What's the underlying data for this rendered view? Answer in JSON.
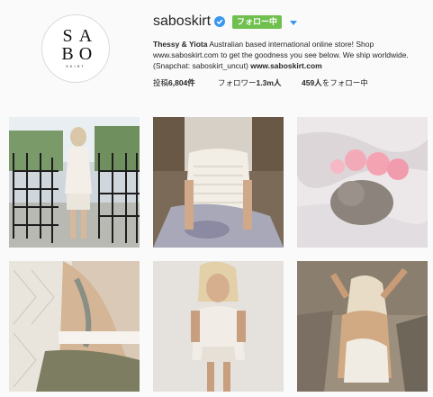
{
  "profile": {
    "avatar_logo": {
      "letters": [
        "S",
        "A",
        "B",
        "O"
      ],
      "subtitle": "SKIRT"
    },
    "username": "saboskirt",
    "follow_button_label": "フォロー中",
    "bio": {
      "name": "Thessy & Yiota",
      "line1_rest": " Australian based international online store! Shop",
      "line2": "www.saboskirt.com to get the goodness you see below. We ship worldwide.",
      "line3_prefix": "(Snapchat: saboskirt_uncut) ",
      "website": "www.saboskirt.com"
    },
    "stats": {
      "posts_label": "投稿",
      "posts_value": "6,804件",
      "followers_label": "フォロワー",
      "followers_value": "1.3m人",
      "following_value": "459人",
      "following_label": "をフォロー中"
    }
  },
  "colors": {
    "follow_button_bg": "#70c050",
    "verified_badge": "#3897f0",
    "page_bg": "#fafafa",
    "text": "#262626"
  },
  "icons": [
    "verified-badge-icon",
    "dropdown-arrow-icon"
  ]
}
